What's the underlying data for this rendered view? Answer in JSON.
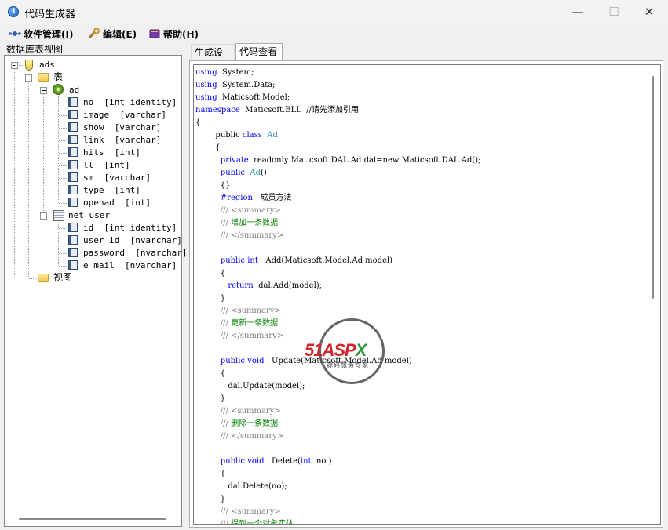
{
  "window": {
    "title": "代码生成器",
    "controls": [
      "—",
      "☐",
      "✕"
    ]
  },
  "menu": [
    {
      "label": "软件管理(I)",
      "icon": "network-icon"
    },
    {
      "label": "编辑(E)",
      "icon": "wrench-icon"
    },
    {
      "label": "帮助(H)",
      "icon": "book-icon"
    }
  ],
  "left_panel": {
    "label": "数据库表视图",
    "tree": {
      "db": "ads",
      "tables_folder": "表",
      "table1": "ad",
      "table1_cols": [
        "no  [int identity]",
        "image  [varchar]",
        "show  [varchar]",
        "link  [varchar]",
        "hits  [int]",
        "ll  [int]",
        "sm  [varchar]",
        "type  [int]",
        "openad  [int]"
      ],
      "table2": "net_user",
      "table2_cols": [
        "id  [int identity]",
        "user_id  [nvarchar]",
        "password  [nvarchar]",
        "e_mail  [nvarchar]"
      ],
      "views_folder": "视图"
    }
  },
  "tabs": [
    {
      "label": "生成设置",
      "active": false
    },
    {
      "label": "代码查看",
      "active": true
    }
  ],
  "code_lines": [
    [
      [
        "kw",
        "using"
      ],
      [
        "",
        "  System;"
      ]
    ],
    [
      [
        "kw",
        "using"
      ],
      [
        "",
        "  System.Data;"
      ]
    ],
    [
      [
        "kw",
        "using"
      ],
      [
        "",
        "  Maticsoft.Model;"
      ]
    ],
    [
      [
        "kw",
        "namespace"
      ],
      [
        "",
        "  Maticsoft.BLL  //请先添加引用"
      ]
    ],
    [
      [
        "",
        "{"
      ]
    ],
    [
      [
        "",
        "        public "
      ],
      [
        "kw",
        "class"
      ],
      [
        "ty",
        "  Ad"
      ]
    ],
    [
      [
        "",
        "        {"
      ]
    ],
    [
      [
        "",
        "          "
      ],
      [
        "kw",
        "private"
      ],
      [
        "",
        "  readonly Maticsoft.DAL.Ad dal=new Maticsoft.DAL.Ad();"
      ]
    ],
    [
      [
        "",
        "          "
      ],
      [
        "kw",
        "public"
      ],
      [
        "ty",
        "  Ad"
      ],
      [
        "",
        "()"
      ]
    ],
    [
      [
        "",
        "          {}"
      ]
    ],
    [
      [
        "",
        "          "
      ],
      [
        "kw",
        "#region"
      ],
      [
        "",
        "   成员方法"
      ]
    ],
    [
      [
        "",
        "          "
      ],
      [
        "gr",
        "/// <summary>"
      ]
    ],
    [
      [
        "",
        "          "
      ],
      [
        "gr",
        "/// "
      ],
      [
        "cm",
        "增加一条数据"
      ]
    ],
    [
      [
        "",
        "          "
      ],
      [
        "gr",
        "/// </summary>"
      ]
    ],
    [
      [
        "",
        ""
      ]
    ],
    [
      [
        "",
        "          "
      ],
      [
        "kw",
        "public int"
      ],
      [
        "",
        "   Add(Maticsoft.Model.Ad model)"
      ]
    ],
    [
      [
        "",
        "          {"
      ]
    ],
    [
      [
        "",
        "             "
      ],
      [
        "kw",
        "return"
      ],
      [
        "",
        "  dal.Add(model);"
      ]
    ],
    [
      [
        "",
        "          }"
      ]
    ],
    [
      [
        "",
        "          "
      ],
      [
        "gr",
        "/// <summary>"
      ]
    ],
    [
      [
        "",
        "          "
      ],
      [
        "gr",
        "/// "
      ],
      [
        "cm",
        "更新一条数据"
      ]
    ],
    [
      [
        "",
        "          "
      ],
      [
        "gr",
        "/// </summary>"
      ]
    ],
    [
      [
        "",
        ""
      ]
    ],
    [
      [
        "",
        "          "
      ],
      [
        "kw",
        "public void"
      ],
      [
        "",
        "   Update(Maticsoft.Model.Ad model)"
      ]
    ],
    [
      [
        "",
        "          {"
      ]
    ],
    [
      [
        "",
        "             dal.Update(model);"
      ]
    ],
    [
      [
        "",
        "          }"
      ]
    ],
    [
      [
        "",
        "          "
      ],
      [
        "gr",
        "/// <summary>"
      ]
    ],
    [
      [
        "",
        "          "
      ],
      [
        "gr",
        "/// "
      ],
      [
        "cm",
        "删除一条数据"
      ]
    ],
    [
      [
        "",
        "          "
      ],
      [
        "gr",
        "/// </summary>"
      ]
    ],
    [
      [
        "",
        ""
      ]
    ],
    [
      [
        "",
        "          "
      ],
      [
        "kw",
        "public void"
      ],
      [
        "",
        "   Delete("
      ],
      [
        "kw",
        "int"
      ],
      [
        "",
        "  no )"
      ]
    ],
    [
      [
        "",
        "          {"
      ]
    ],
    [
      [
        "",
        "             dal.Delete(no);"
      ]
    ],
    [
      [
        "",
        "          }"
      ]
    ],
    [
      [
        "",
        "          "
      ],
      [
        "gr",
        "/// <summary>"
      ]
    ],
    [
      [
        "",
        "          "
      ],
      [
        "gr",
        "/// "
      ],
      [
        "cm",
        "得到一个对象实体"
      ]
    ]
  ],
  "watermark": {
    "brand_a": "51",
    "brand_b": "ASP",
    "brand_c": "X",
    "sub": "源码服务专家"
  }
}
